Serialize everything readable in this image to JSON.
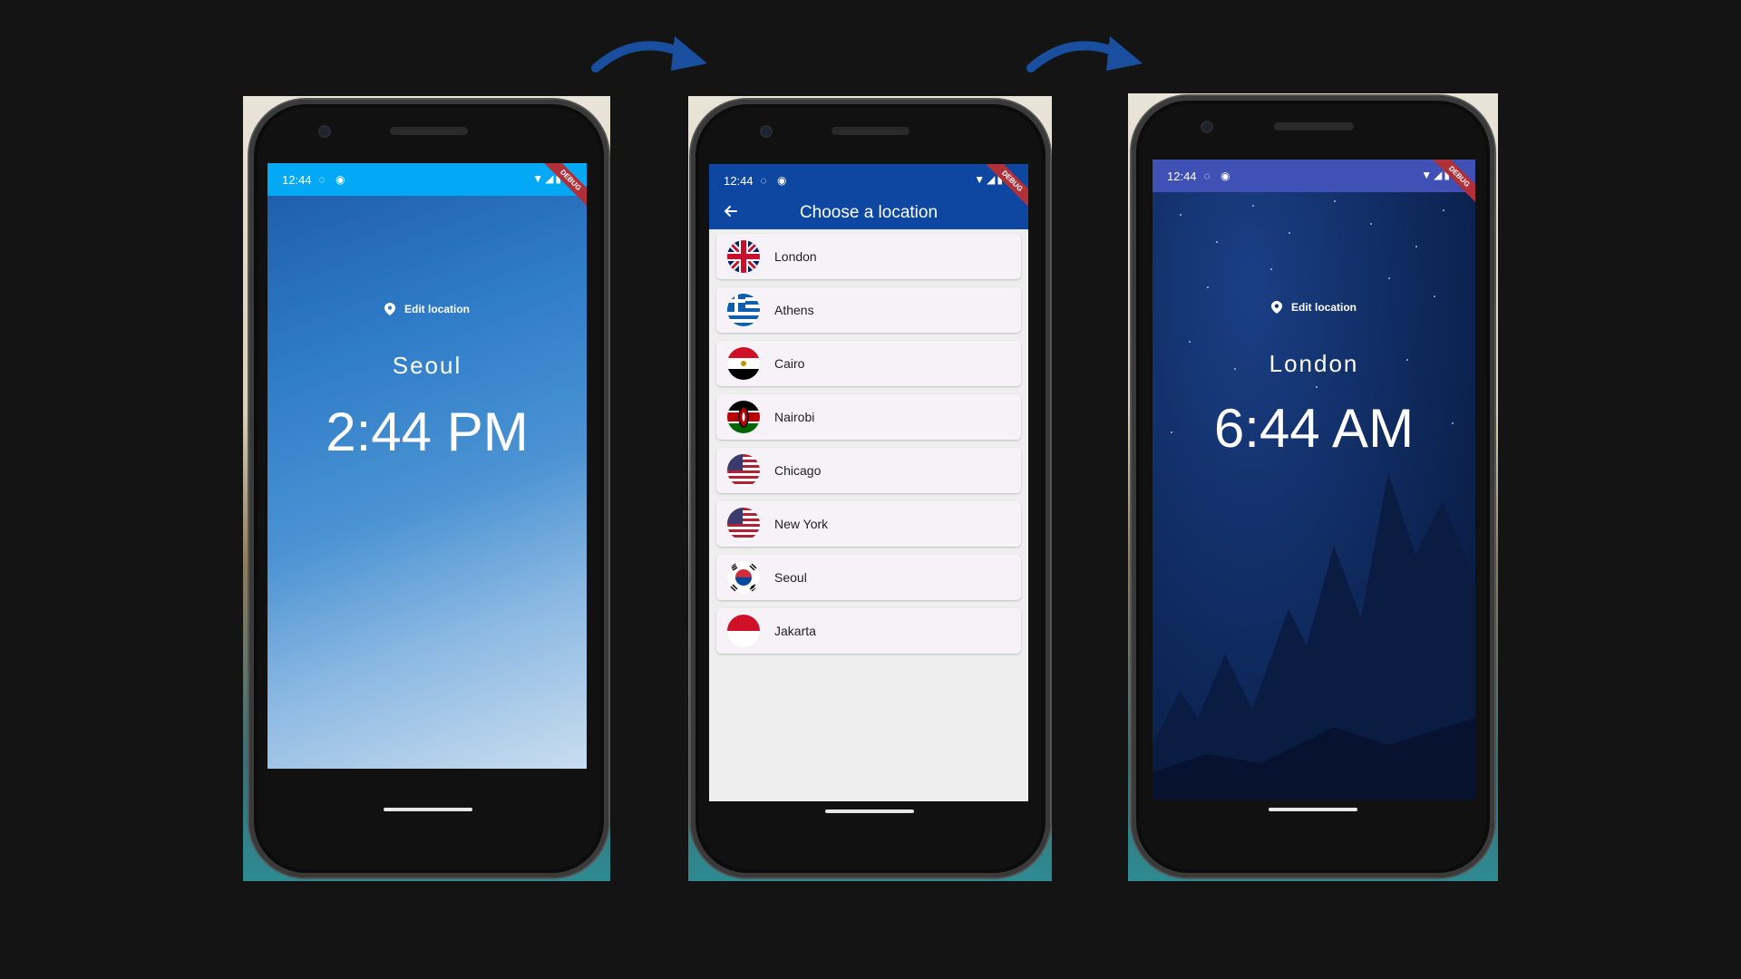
{
  "phone_1": {
    "status_time": "12:44",
    "edit_label": "Edit location",
    "city": "Seoul",
    "time": "2:44 PM",
    "debug": "DEBUG"
  },
  "phone_2": {
    "status_time": "12:44",
    "title": "Choose a location",
    "debug": "DEBUG",
    "locations": [
      {
        "label": "London",
        "flag": "uk-flag-icon"
      },
      {
        "label": "Athens",
        "flag": "greece-flag-icon"
      },
      {
        "label": "Cairo",
        "flag": "egypt-flag-icon"
      },
      {
        "label": "Nairobi",
        "flag": "kenya-flag-icon"
      },
      {
        "label": "Chicago",
        "flag": "usa-flag-icon"
      },
      {
        "label": "New York",
        "flag": "usa-flag-icon"
      },
      {
        "label": "Seoul",
        "flag": "south-korea-flag-icon"
      },
      {
        "label": "Jakarta",
        "flag": "indonesia-flag-icon"
      }
    ]
  },
  "phone_3": {
    "status_time": "12:44",
    "edit_label": "Edit location",
    "city": "London",
    "time": "6:44 AM",
    "debug": "DEBUG"
  },
  "colors": {
    "appbar": "#0d47a1",
    "status_day": "#03a9f4",
    "status_night": "#3f51b5",
    "arrow": "#1a4fa0"
  }
}
